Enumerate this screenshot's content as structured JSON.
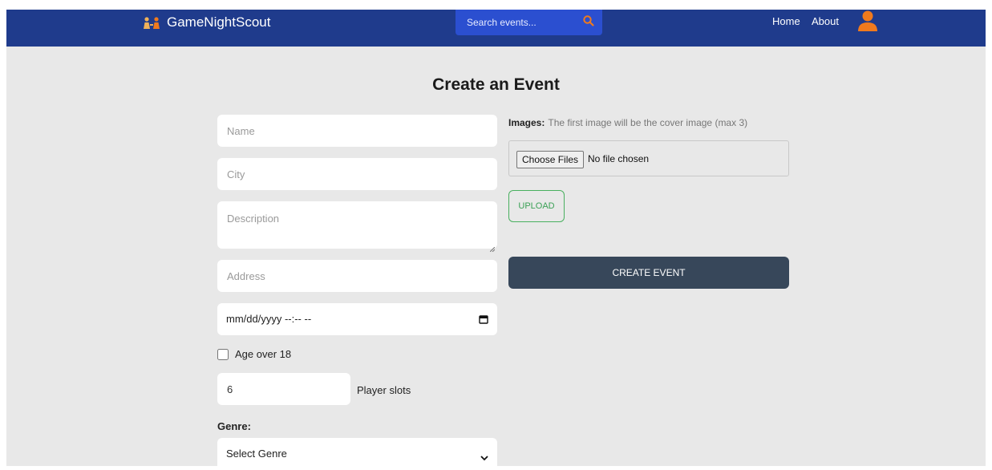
{
  "app": {
    "brand": "GameNightScout",
    "brand_colors": {
      "figure_light": "#f0b15a",
      "figure_dark": "#f07a1d"
    }
  },
  "header": {
    "background": "#1f3b8c",
    "search": {
      "placeholder": "Search events...",
      "icon": "search-icon",
      "icon_color": "#f07a1d"
    },
    "nav": [
      {
        "label": "Home"
      },
      {
        "label": "About"
      }
    ],
    "avatar": {
      "icon": "user-icon",
      "color": "#f07a1d"
    }
  },
  "form": {
    "title": "Create an Event",
    "name": {
      "placeholder": "Name",
      "value": ""
    },
    "city": {
      "placeholder": "City",
      "value": ""
    },
    "description": {
      "placeholder": "Description",
      "value": ""
    },
    "address": {
      "placeholder": "Address",
      "value": ""
    },
    "datetime": {
      "placeholder": "mm/dd/yyyy --:-- --",
      "icon": "calendar-icon"
    },
    "age_over_18": {
      "label": "Age over 18",
      "checked": false
    },
    "player_slots": {
      "value": "6",
      "label": "Player slots"
    },
    "genre": {
      "label": "Genre:",
      "selected": "Select Genre"
    },
    "images": {
      "label": "Images:",
      "hint": "The first image will be the cover image (max 3)",
      "choose_button": "Choose Files",
      "file_status": "No file chosen"
    },
    "upload_button": "UPLOAD",
    "create_button": "CREATE EVENT"
  },
  "colors": {
    "page_background": "#e8e8e8",
    "create_button": "#37475a",
    "upload_accent": "#49b05f"
  }
}
